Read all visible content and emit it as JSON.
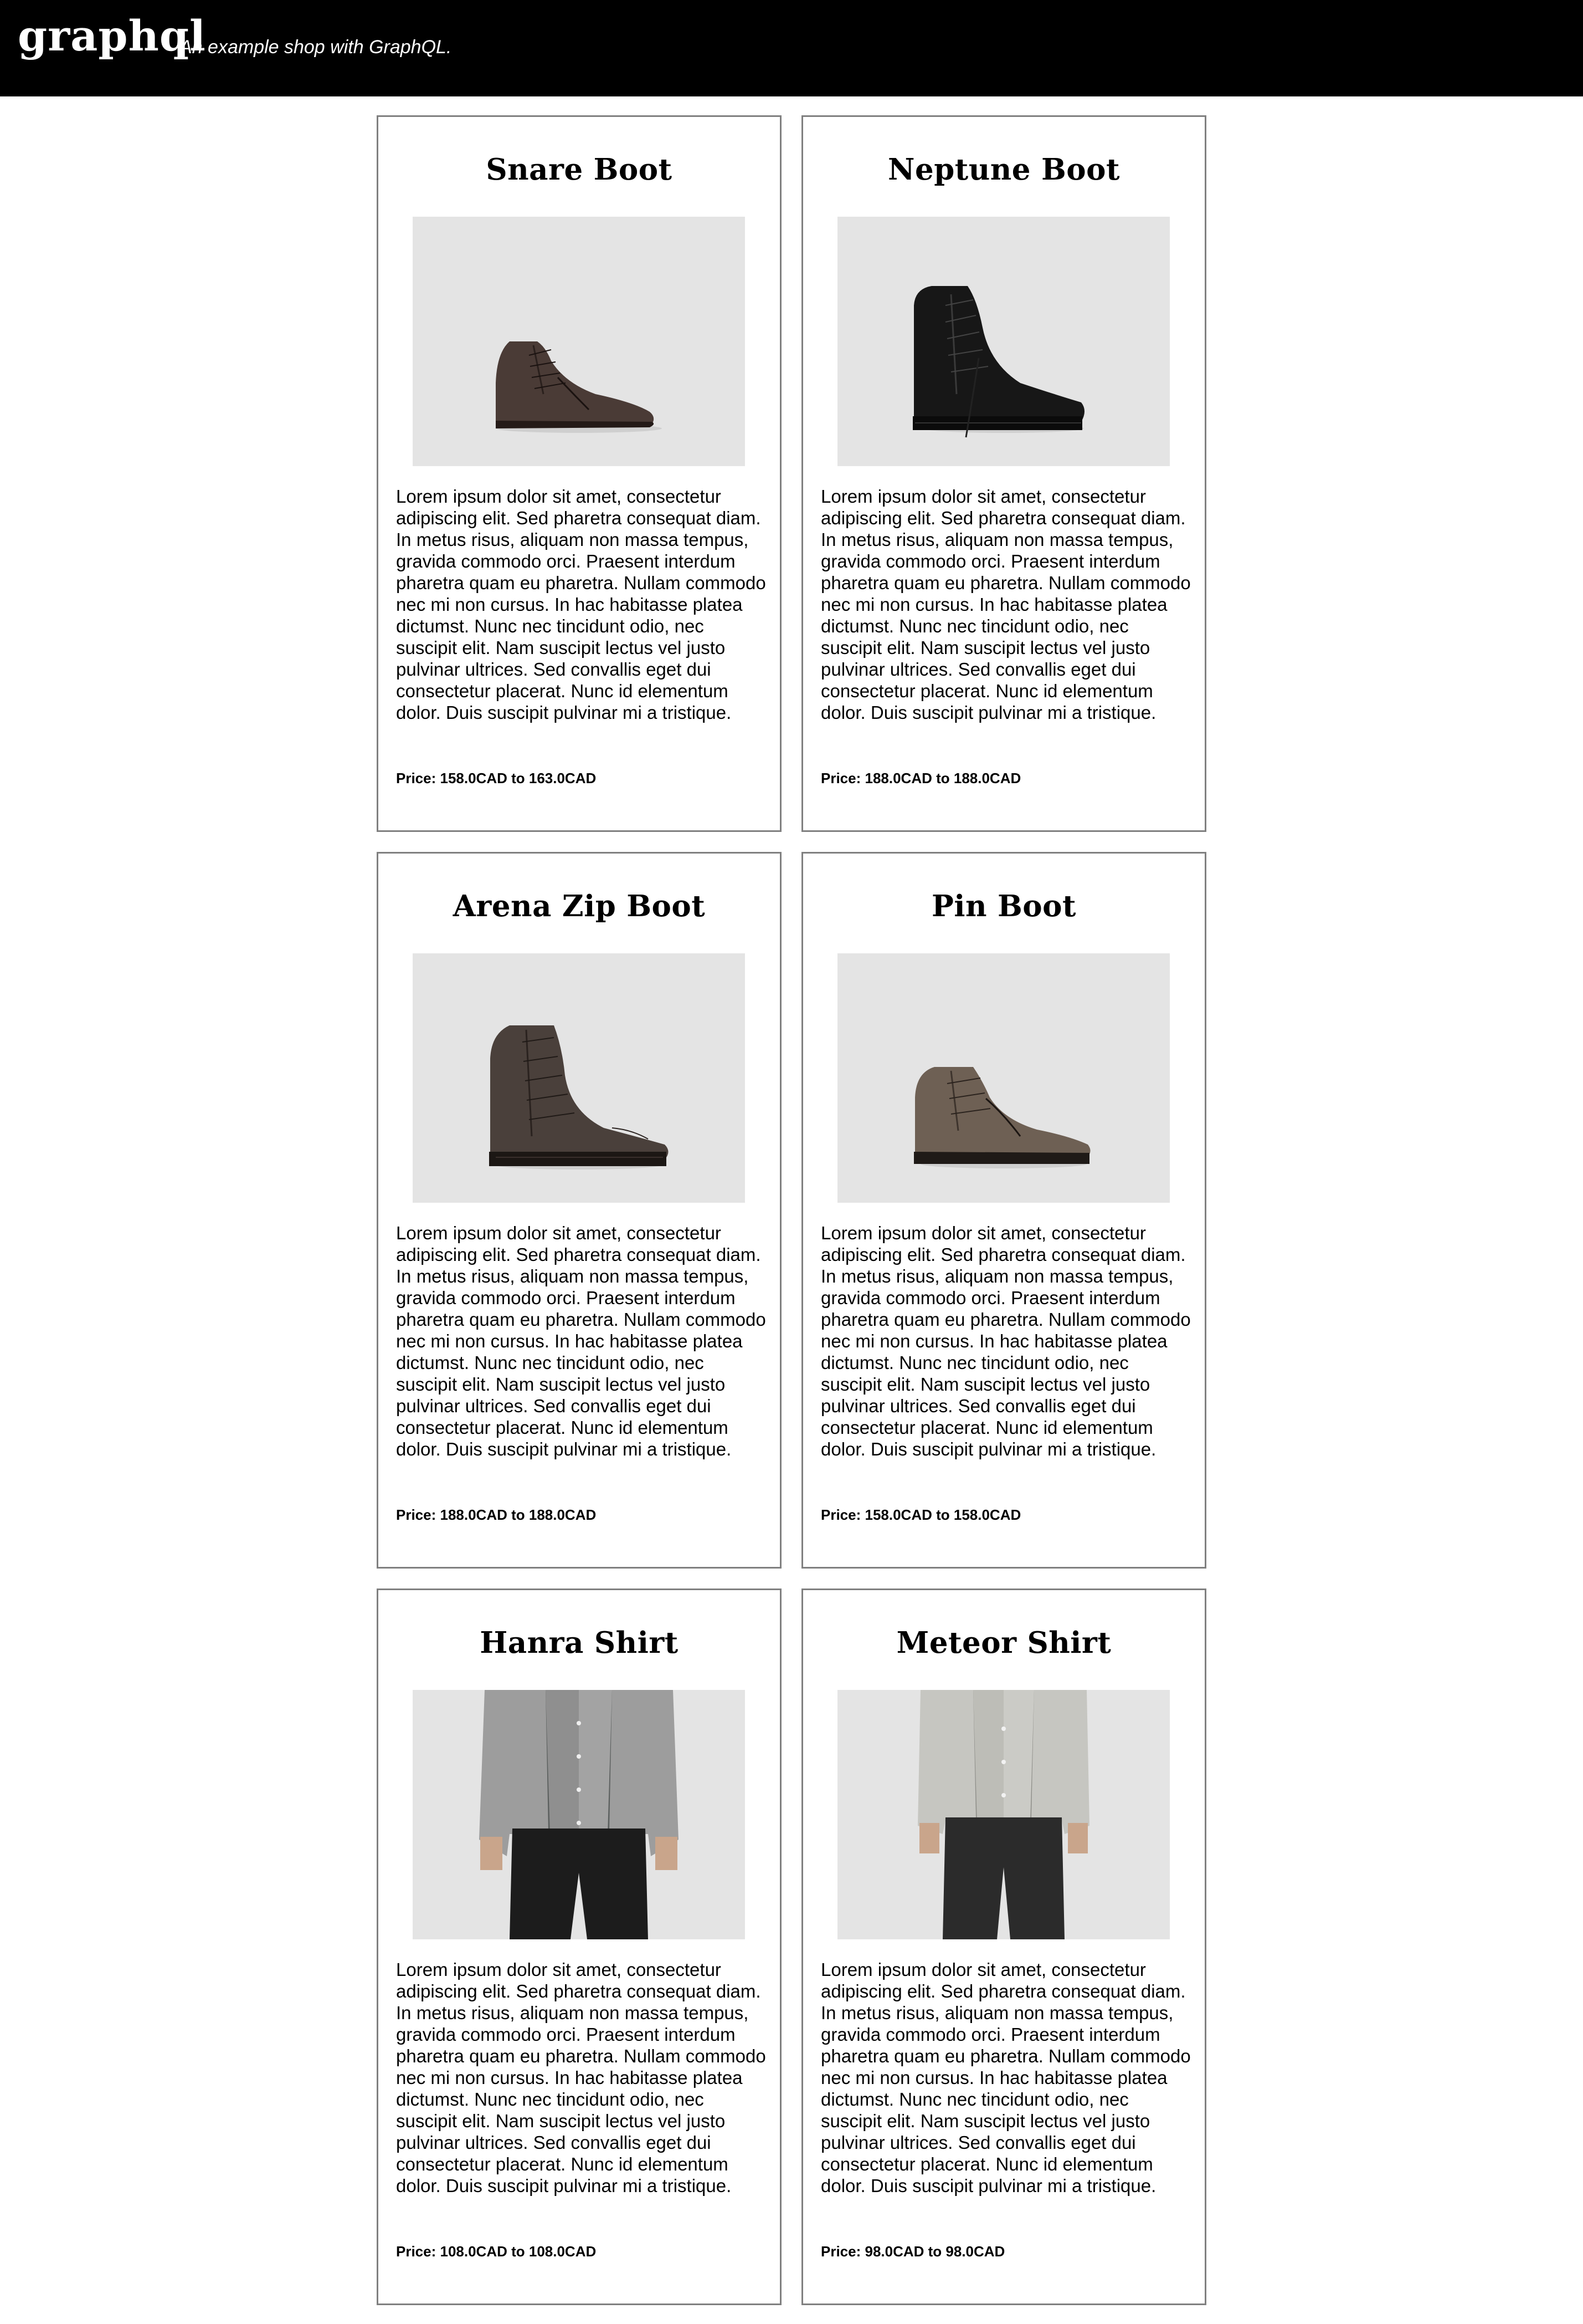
{
  "header": {
    "brand": "graphql",
    "tagline": "An example shop with GraphQL."
  },
  "products": [
    {
      "name": "Snare Boot",
      "image_icon": "snare-boot-image",
      "description": "Lorem ipsum dolor sit amet, consectetur adipiscing elit. Sed pharetra consequat diam. In metus risus, aliquam non massa tempus, gravida commodo orci. Praesent interdum pharetra quam eu pharetra. Nullam commodo nec mi non cursus. In hac habitasse platea dictumst. Nunc nec tincidunt odio, nec suscipit elit. Nam suscipit lectus vel justo pulvinar ultrices. Sed convallis eget dui consectetur placerat. Nunc id elementum dolor. Duis suscipit pulvinar mi a tristique.",
      "price": "Price: 158.0CAD to 163.0CAD"
    },
    {
      "name": "Neptune Boot",
      "image_icon": "neptune-boot-image",
      "description": "Lorem ipsum dolor sit amet, consectetur adipiscing elit. Sed pharetra consequat diam. In metus risus, aliquam non massa tempus, gravida commodo orci. Praesent interdum pharetra quam eu pharetra. Nullam commodo nec mi non cursus. In hac habitasse platea dictumst. Nunc nec tincidunt odio, nec suscipit elit. Nam suscipit lectus vel justo pulvinar ultrices. Sed convallis eget dui consectetur placerat. Nunc id elementum dolor. Duis suscipit pulvinar mi a tristique.",
      "price": "Price: 188.0CAD to 188.0CAD"
    },
    {
      "name": "Arena Zip Boot",
      "image_icon": "arena-zip-boot-image",
      "description": "Lorem ipsum dolor sit amet, consectetur adipiscing elit. Sed pharetra consequat diam. In metus risus, aliquam non massa tempus, gravida commodo orci. Praesent interdum pharetra quam eu pharetra. Nullam commodo nec mi non cursus. In hac habitasse platea dictumst. Nunc nec tincidunt odio, nec suscipit elit. Nam suscipit lectus vel justo pulvinar ultrices. Sed convallis eget dui consectetur placerat. Nunc id elementum dolor. Duis suscipit pulvinar mi a tristique.",
      "price": "Price: 188.0CAD to 188.0CAD"
    },
    {
      "name": "Pin Boot",
      "image_icon": "pin-boot-image",
      "description": "Lorem ipsum dolor sit amet, consectetur adipiscing elit. Sed pharetra consequat diam. In metus risus, aliquam non massa tempus, gravida commodo orci. Praesent interdum pharetra quam eu pharetra. Nullam commodo nec mi non cursus. In hac habitasse platea dictumst. Nunc nec tincidunt odio, nec suscipit elit. Nam suscipit lectus vel justo pulvinar ultrices. Sed convallis eget dui consectetur placerat. Nunc id elementum dolor. Duis suscipit pulvinar mi a tristique.",
      "price": "Price: 158.0CAD to 158.0CAD"
    },
    {
      "name": "Hanra Shirt",
      "image_icon": "hanra-shirt-image",
      "description": "Lorem ipsum dolor sit amet, consectetur adipiscing elit. Sed pharetra consequat diam. In metus risus, aliquam non massa tempus, gravida commodo orci. Praesent interdum pharetra quam eu pharetra. Nullam commodo nec mi non cursus. In hac habitasse platea dictumst. Nunc nec tincidunt odio, nec suscipit elit. Nam suscipit lectus vel justo pulvinar ultrices. Sed convallis eget dui consectetur placerat. Nunc id elementum dolor. Duis suscipit pulvinar mi a tristique.",
      "price": "Price: 108.0CAD to 108.0CAD"
    },
    {
      "name": "Meteor Shirt",
      "image_icon": "meteor-shirt-image",
      "description": "Lorem ipsum dolor sit amet, consectetur adipiscing elit. Sed pharetra consequat diam. In metus risus, aliquam non massa tempus, gravida commodo orci. Praesent interdum pharetra quam eu pharetra. Nullam commodo nec mi non cursus. In hac habitasse platea dictumst. Nunc nec tincidunt odio, nec suscipit elit. Nam suscipit lectus vel justo pulvinar ultrices. Sed convallis eget dui consectetur placerat. Nunc id elementum dolor. Duis suscipit pulvinar mi a tristique.",
      "price": "Price: 98.0CAD to 98.0CAD"
    }
  ],
  "colors": {
    "header_bg": "#000000",
    "card_border": "#808080",
    "image_bg": "#e4e4e4"
  }
}
